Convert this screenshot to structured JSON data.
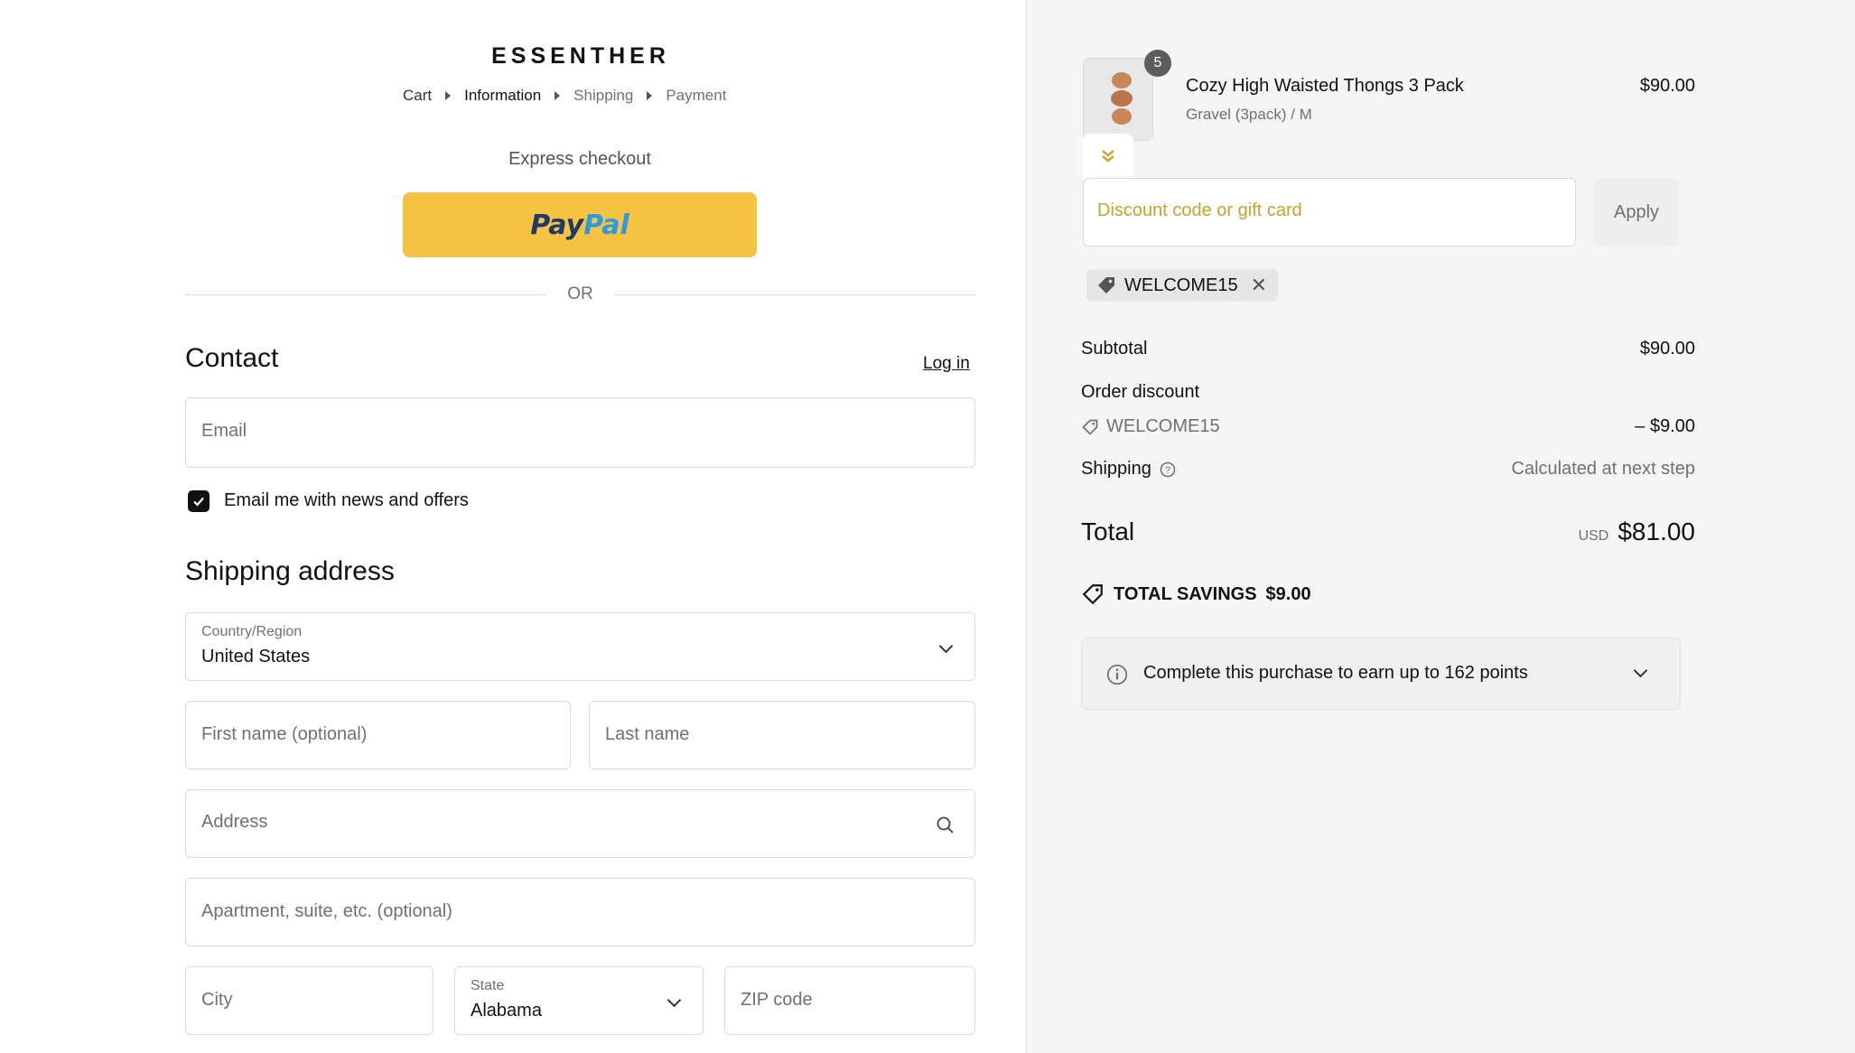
{
  "brand": {
    "logo_text": "ESSENTHER"
  },
  "breadcrumb": {
    "cart": "Cart",
    "information": "Information",
    "shipping": "Shipping",
    "payment": "Payment"
  },
  "express": {
    "label": "Express checkout",
    "paypal_a": "Pay",
    "paypal_b": "Pal",
    "or_label": "OR"
  },
  "contact": {
    "heading": "Contact",
    "login_link": "Log in",
    "email_placeholder": "Email",
    "newsletter_label": "Email me with news and offers",
    "newsletter_checked": true
  },
  "shipping_address": {
    "heading": "Shipping address",
    "country_label": "Country/Region",
    "country_value": "United States",
    "first_name_placeholder": "First name (optional)",
    "last_name_placeholder": "Last name",
    "address_placeholder": "Address",
    "apartment_placeholder": "Apartment, suite, etc. (optional)",
    "city_placeholder": "City",
    "state_label": "State",
    "state_value": "Alabama",
    "zip_placeholder": "ZIP code"
  },
  "order": {
    "item": {
      "quantity": "5",
      "title": "Cozy High Waisted Thongs 3 Pack",
      "variant": "Gravel (3pack) / M",
      "price": "$90.00"
    },
    "discount_placeholder": "Discount code or gift card",
    "apply_label": "Apply",
    "applied_code": "WELCOME15",
    "subtotal_label": "Subtotal",
    "subtotal_value": "$90.00",
    "order_discount_label": "Order discount",
    "discount_code": "WELCOME15",
    "discount_value": "– $9.00",
    "shipping_label": "Shipping",
    "shipping_value": "Calculated at next step",
    "total_label": "Total",
    "total_currency": "USD",
    "total_value": "$81.00",
    "savings_label": "TOTAL SAVINGS",
    "savings_value": "$9.00",
    "points_text": "Complete this purchase to earn up to 162 points"
  },
  "colors": {
    "paypal_yellow": "#f5c242",
    "discount_placeholder": "#c9a227",
    "text": "#111111",
    "muted": "#707070"
  }
}
